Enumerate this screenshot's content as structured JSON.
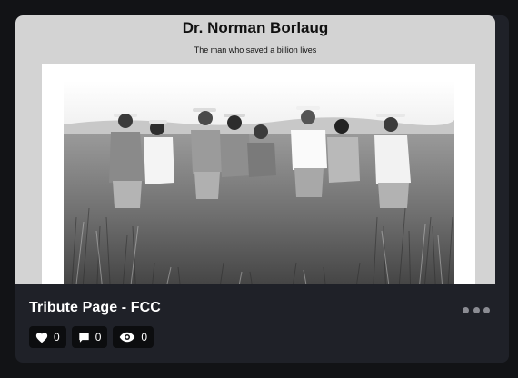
{
  "preview": {
    "heading": "Dr. Norman Borlaug",
    "subheading": "The man who saved a billion lives",
    "image_alt": "black-and-white photo of men in a wheat field"
  },
  "card": {
    "title": "Tribute Page - FCC",
    "more_icon": "ellipsis-icon",
    "stats": {
      "likes": {
        "icon": "heart-icon",
        "value": "0"
      },
      "comments": {
        "icon": "comment-icon",
        "value": "0"
      },
      "views": {
        "icon": "eye-icon",
        "value": "0"
      }
    }
  },
  "colors": {
    "background": "#121316",
    "card": "#1f2128",
    "preview_bg": "#d3d3d3",
    "stat_bg": "#0c0d0f",
    "muted": "#8b8c93"
  }
}
